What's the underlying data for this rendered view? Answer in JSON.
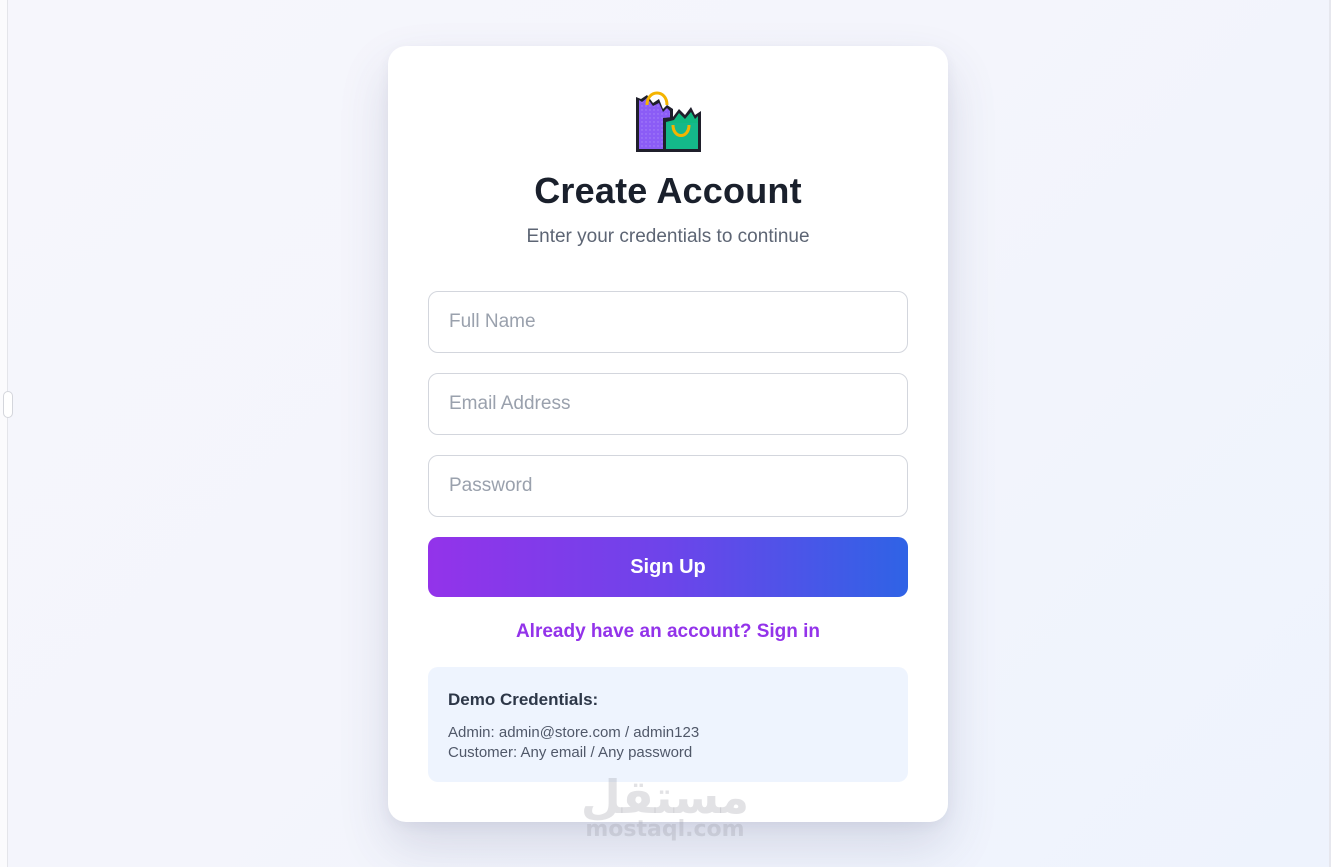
{
  "page": {
    "title": "Create Account",
    "subtitle": "Enter your credentials to continue",
    "logo_icon": "shopping-bags-icon"
  },
  "form": {
    "full_name": {
      "placeholder": "Full Name",
      "value": ""
    },
    "email": {
      "placeholder": "Email Address",
      "value": ""
    },
    "password": {
      "placeholder": "Password",
      "value": ""
    },
    "submit_label": "Sign Up",
    "signin_link": "Already have an account? Sign in"
  },
  "demo": {
    "title": "Demo Credentials:",
    "admin": "Admin: admin@store.com / admin123",
    "customer": "Customer: Any email / Any password"
  },
  "watermark": {
    "arabic": "مستقل",
    "latin": "mostaql.com"
  },
  "colors": {
    "accent_purple": "#9333ea",
    "accent_blue": "#2f63e6",
    "title_text": "#1a202c",
    "demo_background": "#eef4fe"
  }
}
